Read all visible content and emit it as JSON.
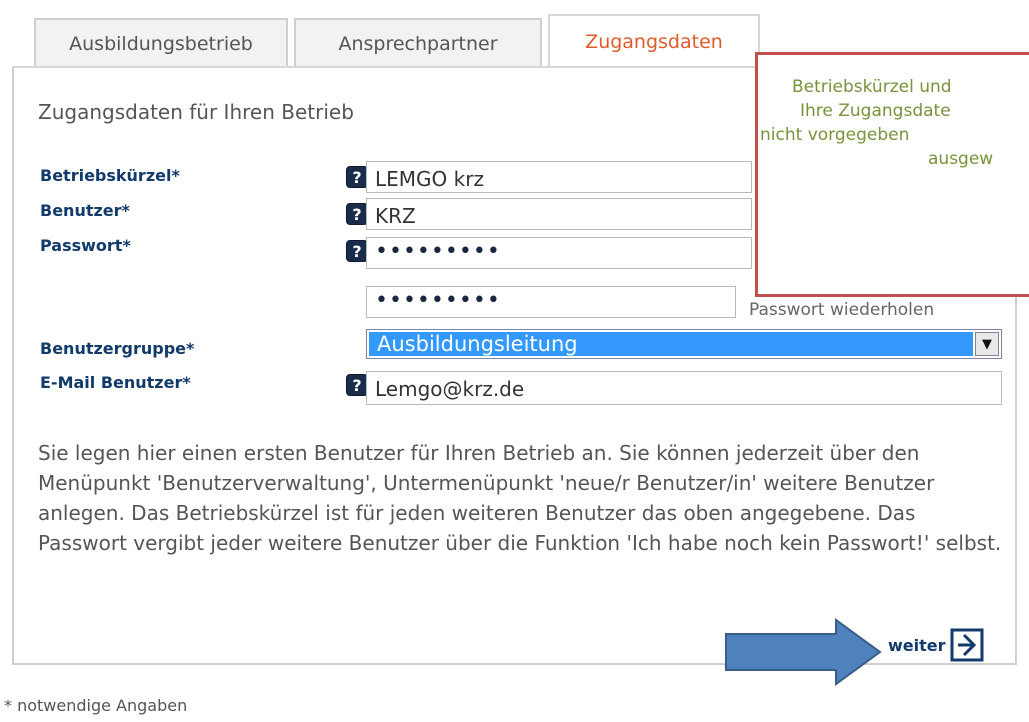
{
  "tabs": [
    {
      "label": "Ausbildungsbetrieb"
    },
    {
      "label": "Ansprechpartner"
    },
    {
      "label": "Zugangsdaten"
    }
  ],
  "section_title": "Zugangsdaten für Ihren Betrieb",
  "fields": {
    "betriebskuerzel": {
      "label": "Betriebskürzel*",
      "value": "LEMGO krz"
    },
    "benutzer": {
      "label": "Benutzer*",
      "value": "KRZ"
    },
    "passwort": {
      "label": "Passwort*",
      "value": "•••••••••"
    },
    "passwort_repeat": {
      "value": "•••••••••",
      "hint": "Passwort wiederholen"
    },
    "benutzergruppe": {
      "label": "Benutzergruppe*",
      "value": "Ausbildungsleitung"
    },
    "email": {
      "label": "E-Mail Benutzer*",
      "value": "Lemgo@krz.de"
    }
  },
  "help_icon_glyph": "?",
  "description": "Sie legen hier einen ersten Benutzer für Ihren Betrieb an. Sie können jederzeit über den Menüpunkt 'Benutzerverwaltung', Untermenüpunkt 'neue/r Benutzer/in' weitere Benutzer anlegen. Das Betriebskürzel ist für jeden weiteren Benutzer das oben angegebene. Das Passwort vergibt jeder weitere Benutzer über die Funktion 'Ich habe noch kein Passwort!' selbst.",
  "callout": {
    "line1": "Betriebskürzel und",
    "line2": "Ihre Zugangsdate",
    "line3": "nicht vorgegeben",
    "line4": "ausgew"
  },
  "next_label": "weiter",
  "footnote": "* notwendige Angaben",
  "colors": {
    "accent_tab": "#e25a2a",
    "label_blue": "#123a6b",
    "selection": "#3399ff",
    "callout_border": "#c0504d",
    "callout_text": "#77933c",
    "arrow_fill": "#4f81bd"
  }
}
